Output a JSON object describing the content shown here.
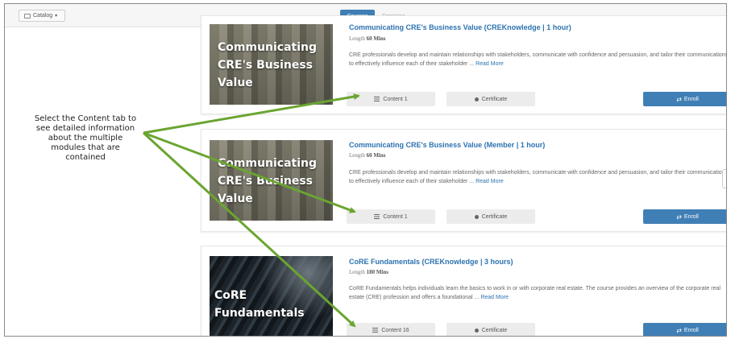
{
  "topbar": {
    "catalog_label": "Catalog",
    "tabs": [
      {
        "label": "Courses",
        "active": true
      },
      {
        "label": "Sessions",
        "active": false
      }
    ]
  },
  "callout": {
    "text": "Select the Content tab to see detailed information about the multiple modules that are contained",
    "arrow_color": "#6aa531"
  },
  "courses": [
    {
      "title": "Communicating CRE's Business Value (CREKnowledge | 1 hour)",
      "length_label": "Length",
      "length_value": "60 Mins",
      "image_caption": "Communicating CRE's Business Value",
      "description": "CRE professionals develop and maintain relationships with stakeholders, communicate with confidence and persuasion, and tailor their communications to effectively influence each of their stakeholder ...",
      "read_more": "Read More",
      "content_label": "Content 1",
      "certificate_label": "Certificate",
      "enroll_label": "Enroll"
    },
    {
      "title": "Communicating CRE's Business Value (Member | 1 hour)",
      "length_label": "Length",
      "length_value": "60 Mins",
      "image_caption": "Communicating CRE's Business Value",
      "description": "CRE professionals develop and maintain relationships with stakeholders, communicate with confidence and persuasion, and tailor their communications to effectively influence each of their stakeholder ...",
      "read_more": "Read More",
      "content_label": "Content 1",
      "certificate_label": "Certificate",
      "enroll_label": "Enroll"
    },
    {
      "title": "CoRE Fundamentals (CREKnowledge | 3 hours)",
      "length_label": "Length",
      "length_value": "180 Mins",
      "image_caption": "CoRE Fundamentals",
      "description": "CoRE Fundamentals helps individuals learn the basics to work in or with corporate real estate. The course provides an overview of the corporate real estate (CRE) profession and offers a foundational ...",
      "read_more": "Read More",
      "content_label": "Content 16",
      "certificate_label": "Certificate",
      "enroll_label": "Enroll"
    }
  ],
  "colors": {
    "accent": "#3f7fb5",
    "link": "#2c72b0"
  }
}
